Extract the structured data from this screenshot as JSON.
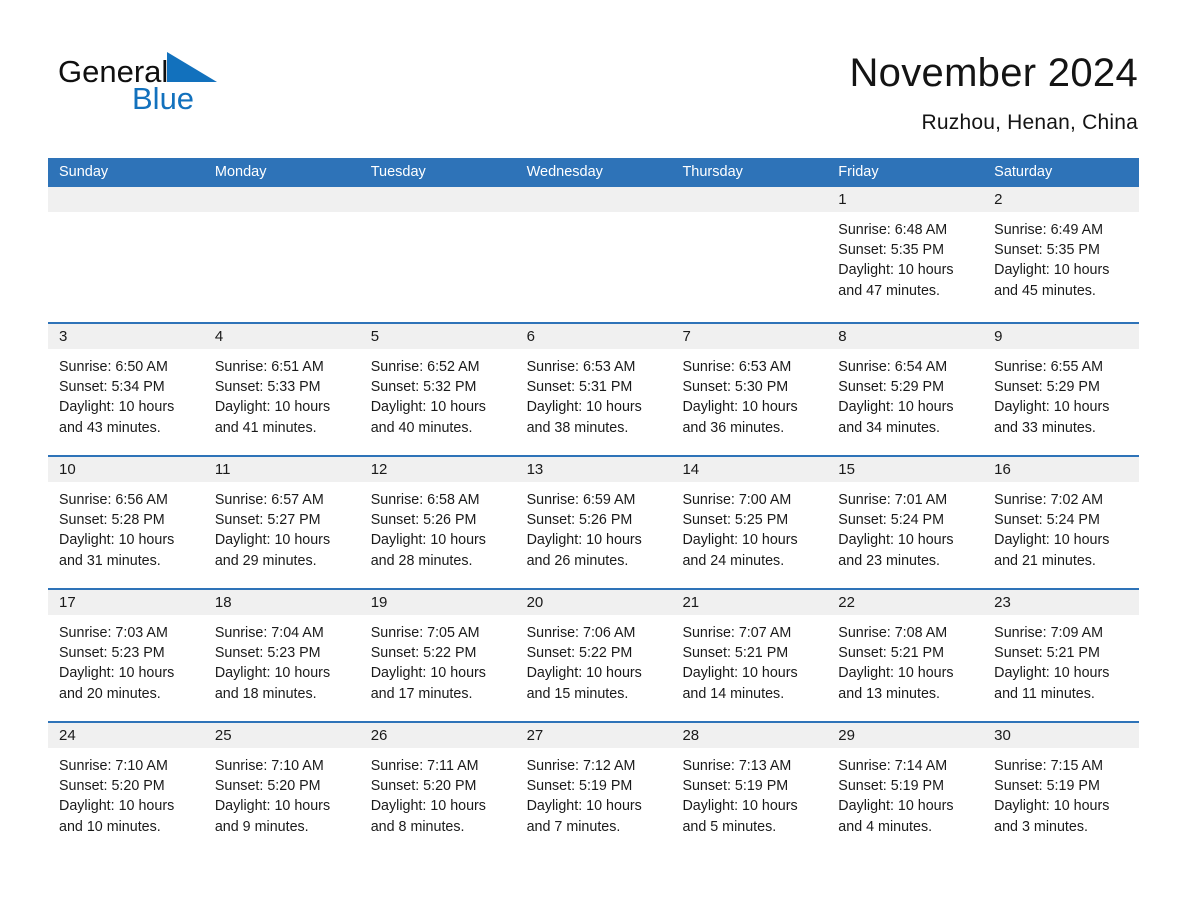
{
  "brand": {
    "word1": "General",
    "word2": "Blue",
    "triangle_color": "#1271bd",
    "word1_color": "#0f0f0f",
    "word2_color": "#1271bd"
  },
  "header": {
    "title": "November 2024",
    "subtitle": "Ruzhou, Henan, China"
  },
  "theme": {
    "header_blue": "#2e73b8",
    "daynum_band": "#f0f0f0",
    "text": "#1a1a1a",
    "cell_background": "#ffffff"
  },
  "calendar": {
    "weekday_headers": [
      "Sunday",
      "Monday",
      "Tuesday",
      "Wednesday",
      "Thursday",
      "Friday",
      "Saturday"
    ],
    "weeks": [
      [
        {
          "day": "",
          "sunrise": "",
          "sunset": "",
          "daylight_line1": "",
          "daylight_line2": ""
        },
        {
          "day": "",
          "sunrise": "",
          "sunset": "",
          "daylight_line1": "",
          "daylight_line2": ""
        },
        {
          "day": "",
          "sunrise": "",
          "sunset": "",
          "daylight_line1": "",
          "daylight_line2": ""
        },
        {
          "day": "",
          "sunrise": "",
          "sunset": "",
          "daylight_line1": "",
          "daylight_line2": ""
        },
        {
          "day": "",
          "sunrise": "",
          "sunset": "",
          "daylight_line1": "",
          "daylight_line2": ""
        },
        {
          "day": "1",
          "sunrise": "Sunrise: 6:48 AM",
          "sunset": "Sunset: 5:35 PM",
          "daylight_line1": "Daylight: 10 hours",
          "daylight_line2": "and 47 minutes."
        },
        {
          "day": "2",
          "sunrise": "Sunrise: 6:49 AM",
          "sunset": "Sunset: 5:35 PM",
          "daylight_line1": "Daylight: 10 hours",
          "daylight_line2": "and 45 minutes."
        }
      ],
      [
        {
          "day": "3",
          "sunrise": "Sunrise: 6:50 AM",
          "sunset": "Sunset: 5:34 PM",
          "daylight_line1": "Daylight: 10 hours",
          "daylight_line2": "and 43 minutes."
        },
        {
          "day": "4",
          "sunrise": "Sunrise: 6:51 AM",
          "sunset": "Sunset: 5:33 PM",
          "daylight_line1": "Daylight: 10 hours",
          "daylight_line2": "and 41 minutes."
        },
        {
          "day": "5",
          "sunrise": "Sunrise: 6:52 AM",
          "sunset": "Sunset: 5:32 PM",
          "daylight_line1": "Daylight: 10 hours",
          "daylight_line2": "and 40 minutes."
        },
        {
          "day": "6",
          "sunrise": "Sunrise: 6:53 AM",
          "sunset": "Sunset: 5:31 PM",
          "daylight_line1": "Daylight: 10 hours",
          "daylight_line2": "and 38 minutes."
        },
        {
          "day": "7",
          "sunrise": "Sunrise: 6:53 AM",
          "sunset": "Sunset: 5:30 PM",
          "daylight_line1": "Daylight: 10 hours",
          "daylight_line2": "and 36 minutes."
        },
        {
          "day": "8",
          "sunrise": "Sunrise: 6:54 AM",
          "sunset": "Sunset: 5:29 PM",
          "daylight_line1": "Daylight: 10 hours",
          "daylight_line2": "and 34 minutes."
        },
        {
          "day": "9",
          "sunrise": "Sunrise: 6:55 AM",
          "sunset": "Sunset: 5:29 PM",
          "daylight_line1": "Daylight: 10 hours",
          "daylight_line2": "and 33 minutes."
        }
      ],
      [
        {
          "day": "10",
          "sunrise": "Sunrise: 6:56 AM",
          "sunset": "Sunset: 5:28 PM",
          "daylight_line1": "Daylight: 10 hours",
          "daylight_line2": "and 31 minutes."
        },
        {
          "day": "11",
          "sunrise": "Sunrise: 6:57 AM",
          "sunset": "Sunset: 5:27 PM",
          "daylight_line1": "Daylight: 10 hours",
          "daylight_line2": "and 29 minutes."
        },
        {
          "day": "12",
          "sunrise": "Sunrise: 6:58 AM",
          "sunset": "Sunset: 5:26 PM",
          "daylight_line1": "Daylight: 10 hours",
          "daylight_line2": "and 28 minutes."
        },
        {
          "day": "13",
          "sunrise": "Sunrise: 6:59 AM",
          "sunset": "Sunset: 5:26 PM",
          "daylight_line1": "Daylight: 10 hours",
          "daylight_line2": "and 26 minutes."
        },
        {
          "day": "14",
          "sunrise": "Sunrise: 7:00 AM",
          "sunset": "Sunset: 5:25 PM",
          "daylight_line1": "Daylight: 10 hours",
          "daylight_line2": "and 24 minutes."
        },
        {
          "day": "15",
          "sunrise": "Sunrise: 7:01 AM",
          "sunset": "Sunset: 5:24 PM",
          "daylight_line1": "Daylight: 10 hours",
          "daylight_line2": "and 23 minutes."
        },
        {
          "day": "16",
          "sunrise": "Sunrise: 7:02 AM",
          "sunset": "Sunset: 5:24 PM",
          "daylight_line1": "Daylight: 10 hours",
          "daylight_line2": "and 21 minutes."
        }
      ],
      [
        {
          "day": "17",
          "sunrise": "Sunrise: 7:03 AM",
          "sunset": "Sunset: 5:23 PM",
          "daylight_line1": "Daylight: 10 hours",
          "daylight_line2": "and 20 minutes."
        },
        {
          "day": "18",
          "sunrise": "Sunrise: 7:04 AM",
          "sunset": "Sunset: 5:23 PM",
          "daylight_line1": "Daylight: 10 hours",
          "daylight_line2": "and 18 minutes."
        },
        {
          "day": "19",
          "sunrise": "Sunrise: 7:05 AM",
          "sunset": "Sunset: 5:22 PM",
          "daylight_line1": "Daylight: 10 hours",
          "daylight_line2": "and 17 minutes."
        },
        {
          "day": "20",
          "sunrise": "Sunrise: 7:06 AM",
          "sunset": "Sunset: 5:22 PM",
          "daylight_line1": "Daylight: 10 hours",
          "daylight_line2": "and 15 minutes."
        },
        {
          "day": "21",
          "sunrise": "Sunrise: 7:07 AM",
          "sunset": "Sunset: 5:21 PM",
          "daylight_line1": "Daylight: 10 hours",
          "daylight_line2": "and 14 minutes."
        },
        {
          "day": "22",
          "sunrise": "Sunrise: 7:08 AM",
          "sunset": "Sunset: 5:21 PM",
          "daylight_line1": "Daylight: 10 hours",
          "daylight_line2": "and 13 minutes."
        },
        {
          "day": "23",
          "sunrise": "Sunrise: 7:09 AM",
          "sunset": "Sunset: 5:21 PM",
          "daylight_line1": "Daylight: 10 hours",
          "daylight_line2": "and 11 minutes."
        }
      ],
      [
        {
          "day": "24",
          "sunrise": "Sunrise: 7:10 AM",
          "sunset": "Sunset: 5:20 PM",
          "daylight_line1": "Daylight: 10 hours",
          "daylight_line2": "and 10 minutes."
        },
        {
          "day": "25",
          "sunrise": "Sunrise: 7:10 AM",
          "sunset": "Sunset: 5:20 PM",
          "daylight_line1": "Daylight: 10 hours",
          "daylight_line2": "and 9 minutes."
        },
        {
          "day": "26",
          "sunrise": "Sunrise: 7:11 AM",
          "sunset": "Sunset: 5:20 PM",
          "daylight_line1": "Daylight: 10 hours",
          "daylight_line2": "and 8 minutes."
        },
        {
          "day": "27",
          "sunrise": "Sunrise: 7:12 AM",
          "sunset": "Sunset: 5:19 PM",
          "daylight_line1": "Daylight: 10 hours",
          "daylight_line2": "and 7 minutes."
        },
        {
          "day": "28",
          "sunrise": "Sunrise: 7:13 AM",
          "sunset": "Sunset: 5:19 PM",
          "daylight_line1": "Daylight: 10 hours",
          "daylight_line2": "and 5 minutes."
        },
        {
          "day": "29",
          "sunrise": "Sunrise: 7:14 AM",
          "sunset": "Sunset: 5:19 PM",
          "daylight_line1": "Daylight: 10 hours",
          "daylight_line2": "and 4 minutes."
        },
        {
          "day": "30",
          "sunrise": "Sunrise: 7:15 AM",
          "sunset": "Sunset: 5:19 PM",
          "daylight_line1": "Daylight: 10 hours",
          "daylight_line2": "and 3 minutes."
        }
      ]
    ]
  }
}
